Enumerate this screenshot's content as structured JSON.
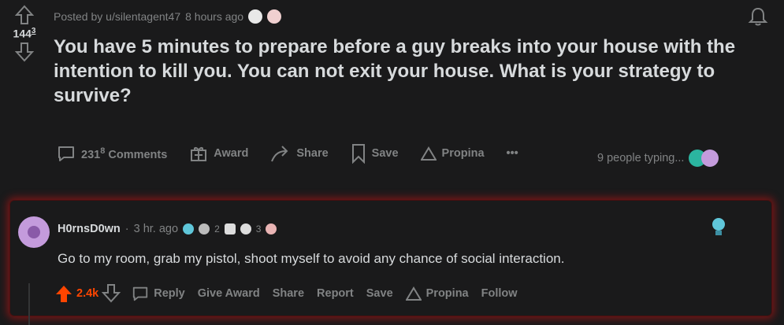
{
  "post": {
    "score": "144",
    "score_sup": "3",
    "posted_by": "Posted by u/silentagent47",
    "time": "8 hours ago",
    "title": "You have 5 minutes to prepare before a guy breaks into your house with the intention to kill you. You can not exit your house. What is your strategy to survive?",
    "comments_count": "231",
    "comments_sup": "8",
    "comments_label": "Comments",
    "award_label": "Award",
    "share_label": "Share",
    "save_label": "Save",
    "propina_label": "Propina",
    "more_label": "•••",
    "typing_text": "9 people typing..."
  },
  "comment": {
    "username": "H0rnsD0wn",
    "sep": "·",
    "time": "3 hr. ago",
    "award_count_1": "2",
    "award_count_2": "3",
    "text": "Go to my room, grab my pistol, shoot myself to avoid any chance of social interaction.",
    "score": "2.4k",
    "reply_label": "Reply",
    "give_award_label": "Give Award",
    "share_label": "Share",
    "report_label": "Report",
    "save_label": "Save",
    "propina_label": "Propina",
    "follow_label": "Follow"
  },
  "colors": {
    "upvote": "#ff4500",
    "background": "#1a1a1b",
    "text": "#d7dadc",
    "muted": "#818384",
    "glow": "#c81414"
  }
}
